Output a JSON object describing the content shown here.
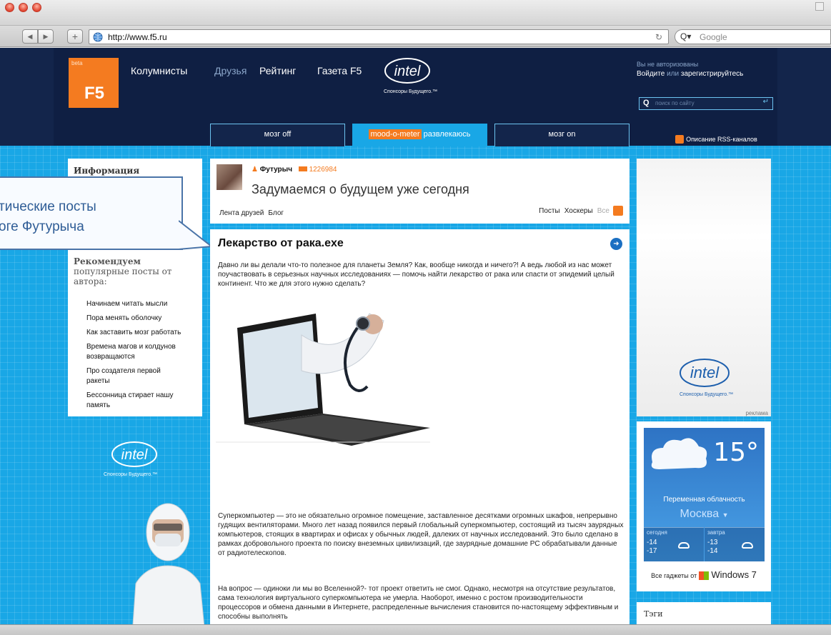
{
  "browser": {
    "url": "http://www.f5.ru",
    "search_placeholder": "Google"
  },
  "header": {
    "logo_beta": "beta",
    "logo_text": "F5",
    "nav": [
      {
        "label": "Колумнисты"
      },
      {
        "label": "Друзья"
      },
      {
        "label": "Рейтинг"
      },
      {
        "label": "Газета F5"
      }
    ],
    "sponsor_logo": "intel",
    "sponsor_tagline": "Спонсоры Будущего.™",
    "auth_status": "Вы не авторизованы",
    "auth_login": "Войдите",
    "auth_or": "или",
    "auth_register": "зарегистрируйтесь",
    "search_placeholder": "поиск по сайту",
    "tabs": [
      {
        "label": "мозг off"
      },
      {
        "badge": "mood-o-meter",
        "label": "развлекаюсь"
      },
      {
        "label": "мозг on"
      }
    ],
    "rss_link": "Описание RSS-каналов"
  },
  "left_sidebar": {
    "info_title": "Информация",
    "recommended_title_1": "Рекомендуем",
    "recommended_title_2": "популярные посты от",
    "recommended_title_3": "автора:",
    "links": [
      "Начинаем читать мысли",
      "Пора менять оболочку",
      "Как заставить мозг работать",
      "Времена магов и колдунов",
      "возвращаются",
      "Про создателя первой",
      "ракеты",
      "Бессонница стирает нашу",
      "память"
    ],
    "sponsor_logo": "intel",
    "sponsor_tagline": "Спонсоры Будущего.™"
  },
  "callout": {
    "line1": "тические посты",
    "line2": "оге Футурыча"
  },
  "blog_header": {
    "author": "Футурыч",
    "rating": "1226984",
    "title": "Задумаемся о будущем уже сегодня",
    "links_left": [
      "Лента друзей",
      "Блог"
    ],
    "links_right": [
      "Посты",
      "Хоскеры",
      "Все"
    ]
  },
  "article": {
    "title": "Лекарство от рака.exe",
    "intro": "Давно ли вы делали что-то полезное для планеты Земля? Как, вообще никогда и ничего?! А ведь любой из нас может поучаствовать в серьезных научных исследованиях — помочь найти лекарство от рака или спасти от эпидемий целый континент. Что же для этого нужно сделать?",
    "para1": "Суперкомпьютер — это не обязательно огромное помещение, заставленное десятками огромных шкафов, непрерывно гудящих вентиляторами. Много лет назад появился первый глобальный суперкомпьютер, состоящий из тысяч заурядных компьютеров, стоящих в квартирах и офисах у обычных людей, далеких от научных исследований. Это было сделано в рамках добровольного проекта по поиску внеземных цивилизаций, где заурядные домашние PC обрабатывали данные от радиотелескопов.",
    "para2": "На вопрос — одиноки ли мы во Вселенной?- тот проект ответить не смог. Однако, несмотря на отсутствие результатов, сама технология виртуального суперкомпьютера не умерла. Наоборот, именно с ростом производительности процессоров и обмена данными в Интернете, распределенные вычисления становится по-настоящему эффективным и способны выполнять"
  },
  "right_ad": {
    "logo": "intel",
    "tagline": "Спонсоры Будущего.™",
    "label": "реклама"
  },
  "weather": {
    "temp": "15°",
    "condition": "Переменная облачность",
    "city": "Москва",
    "today_label": "сегодня",
    "today_high": "-14",
    "today_low": "-17",
    "tomorrow_label": "завтра",
    "tomorrow_high": "-13",
    "tomorrow_low": "-14",
    "gadgets_text": "Все гаджеты от",
    "windows_text": "Windows 7"
  },
  "tags": {
    "title": "Тэги"
  },
  "colors": {
    "brand_orange": "#f47b20",
    "header_navy": "#0f1f43",
    "page_blue": "#19a7e6"
  }
}
